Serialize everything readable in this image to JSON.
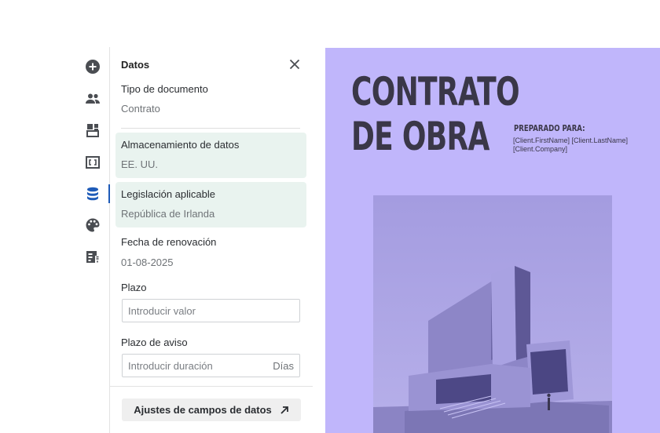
{
  "rail": {
    "items": [
      {
        "icon": "add-circle-icon",
        "active": false
      },
      {
        "icon": "people-icon",
        "active": false
      },
      {
        "icon": "blocks-icon",
        "active": false
      },
      {
        "icon": "variable-frame-icon",
        "active": false
      },
      {
        "icon": "database-icon",
        "active": true
      },
      {
        "icon": "palette-icon",
        "active": false
      },
      {
        "icon": "form-fields-icon",
        "active": false
      }
    ],
    "accent": "#1e5bb8"
  },
  "panel": {
    "title": "Datos",
    "doc_type": {
      "label": "Tipo de documento",
      "value": "Contrato"
    },
    "storage": {
      "label": "Almacenamiento de datos",
      "value": "EE. UU."
    },
    "law": {
      "label": "Legislación aplicable",
      "value": "República de Irlanda"
    },
    "renewal": {
      "label": "Fecha de renovación",
      "value": "01-08-2025"
    },
    "term": {
      "label": "Plazo",
      "placeholder": "Introducir valor"
    },
    "notice": {
      "label": "Plazo de aviso",
      "placeholder": "Introducir duración",
      "suffix": "Días"
    },
    "settings_button": "Ajustes de campos de datos",
    "highlight_color": "#e9f3ef"
  },
  "document": {
    "title_line1": "CONTRATO",
    "title_line2": "DE OBRA",
    "prepared_for_label": "PREPARADO PARA:",
    "prepared_for_value": "[Client.FirstName] [Client.LastName] [Client.Company]",
    "background": "#c0b6fb"
  }
}
